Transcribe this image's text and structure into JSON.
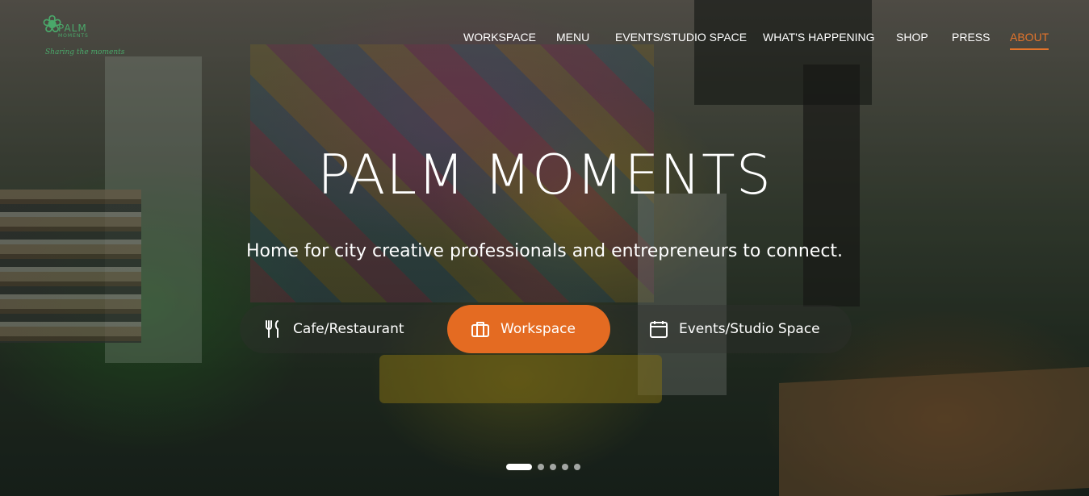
{
  "brand": {
    "logo_name": "PALM",
    "logo_sub": "MOMENTS",
    "tagline": "Sharing the moments",
    "logo_color": "#4aa86a"
  },
  "nav": {
    "items": [
      {
        "label": "WORKSPACE",
        "active": false
      },
      {
        "label": "MENU",
        "active": false
      },
      {
        "label": "EVENTS/STUDIO SPACE",
        "active": false
      },
      {
        "label": "WHAT'S HAPPENING",
        "active": false
      },
      {
        "label": "SHOP",
        "active": false
      },
      {
        "label": "PRESS",
        "active": false
      },
      {
        "label": "ABOUT",
        "active": true
      }
    ],
    "active_color": "#e3742b"
  },
  "hero": {
    "title": "PALM MOMENTS",
    "subtitle": "Home for city creative professionals and entrepreneurs to connect.",
    "tabs": [
      {
        "label": "Cafe/Restaurant",
        "icon": "fork-knife-icon",
        "active": false
      },
      {
        "label": "Workspace",
        "icon": "briefcase-icon",
        "active": true
      },
      {
        "label": "Events/Studio Space",
        "icon": "calendar-icon",
        "active": false
      }
    ],
    "accent_color": "#e46b22",
    "slides": {
      "count": 5,
      "current": 1
    }
  }
}
